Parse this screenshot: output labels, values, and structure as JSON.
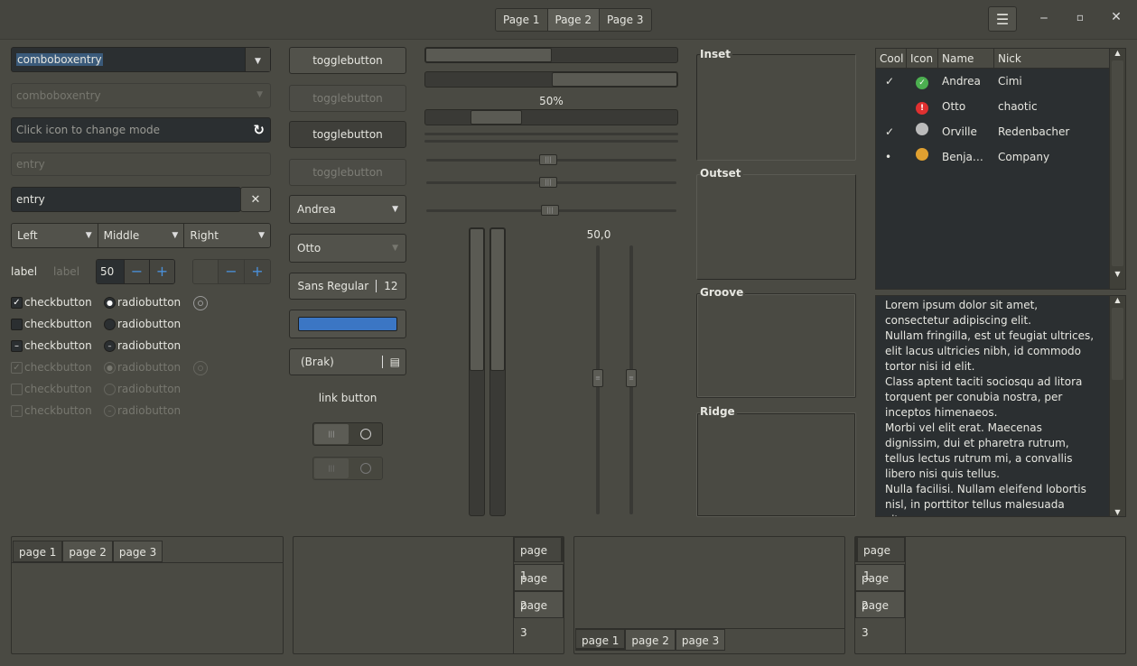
{
  "header": {
    "tabs": [
      "Page 1",
      "Page 2",
      "Page 3"
    ],
    "selected": 1,
    "menu_icon": "hamburger-icon",
    "minimize_icon": "minimize-icon",
    "maximize_icon": "maximize-icon",
    "close_icon": "close-icon"
  },
  "col1": {
    "combo1": "comboboxentry",
    "combo2": "comboboxentry",
    "entry_icon_placeholder": "Click icon to change mode",
    "entry_ins": "entry",
    "entry_clear": "entry",
    "combo_left": "Left",
    "combo_middle": "Middle",
    "combo_right": "Right",
    "label1": "label",
    "label2": "label",
    "spin_value": "50",
    "checkbutton": "checkbutton",
    "radiobutton": "radiobutton"
  },
  "col2": {
    "toggle": "togglebutton",
    "combo_andrea": "Andrea",
    "combo_otto": "Otto",
    "font_name": "Sans Regular",
    "font_size": "12",
    "color": "#3b76c4",
    "file": "(Brak)",
    "link": "link button"
  },
  "col3": {
    "progress_label": "50%",
    "scale_value": "50,0",
    "progress1": 0.5,
    "progress2": 0.5,
    "progress3": 0.38
  },
  "frames": {
    "inset": "Inset",
    "outset": "Outset",
    "groove": "Groove",
    "ridge": "Ridge"
  },
  "tree": {
    "headers": [
      "Cool",
      "Icon",
      "Name",
      "Nick"
    ],
    "rows": [
      {
        "cool": "✓",
        "icon": "check-circle-icon",
        "name": "Andrea",
        "nick": "Cimi"
      },
      {
        "cool": "",
        "icon": "error-circle-icon",
        "name": "Otto",
        "nick": "chaotic"
      },
      {
        "cool": "✓",
        "icon": "gray-circle-icon",
        "name": "Orville",
        "nick": "Redenbacher"
      },
      {
        "cool": "•",
        "icon": "monkey-icon",
        "name": "Benja…",
        "nick": "Company"
      }
    ]
  },
  "text": {
    "p1": "Lorem ipsum dolor sit amet, consectetur adipiscing elit.",
    "p2": "Nullam fringilla, est ut feugiat ultrices, elit lacus ultricies nibh, id commodo tortor nisi id elit.",
    "p3": "Class aptent taciti sociosqu ad litora torquent per conubia nostra, per inceptos himenaeos.",
    "p4": "Morbi vel elit erat. Maecenas dignissim, dui et pharetra rutrum, tellus lectus rutrum mi, a convallis libero nisi quis tellus.",
    "p5": "Nulla facilisi. Nullam eleifend lobortis nisl, in porttitor tellus malesuada vitae."
  },
  "notebooks": {
    "tabs": [
      "page 1",
      "page 2",
      "page 3"
    ]
  }
}
